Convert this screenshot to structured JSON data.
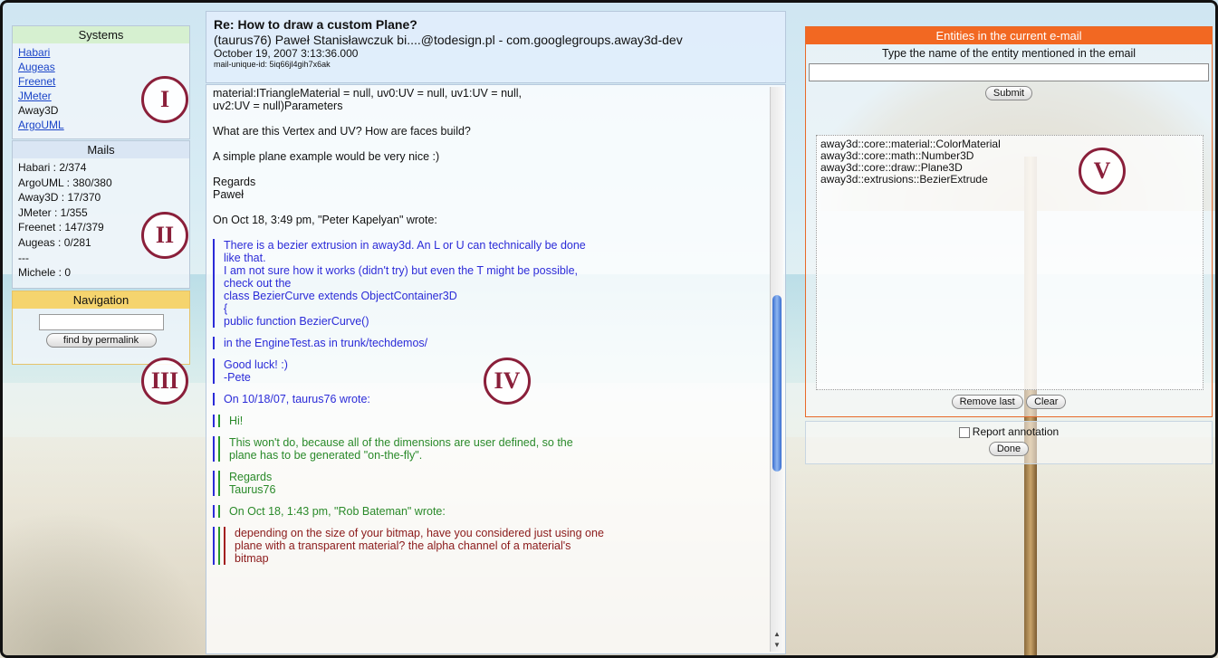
{
  "systems": {
    "title": "Systems",
    "items": [
      {
        "label": "Habari",
        "link": true
      },
      {
        "label": "Augeas",
        "link": true
      },
      {
        "label": "Freenet",
        "link": true
      },
      {
        "label": "JMeter",
        "link": true
      },
      {
        "label": "Away3D",
        "link": false
      },
      {
        "label": "ArgoUML",
        "link": true
      }
    ]
  },
  "mails": {
    "title": "Mails",
    "items": [
      "Habari : 2/374",
      "ArgoUML : 380/380",
      "Away3D : 17/370",
      "JMeter : 1/355",
      "Freenet : 147/379",
      "Augeas : 0/281",
      "---",
      "Michele : 0"
    ]
  },
  "navigation": {
    "title": "Navigation",
    "input_value": "",
    "button_label": "find by permalink"
  },
  "markers": [
    "I",
    "II",
    "III",
    "IV",
    "V"
  ],
  "email": {
    "subject": "Re: How to draw a custom Plane?",
    "from": "(taurus76) Paweł Stanisławczuk bi....@todesign.pl - com.googlegroups.away3d-dev",
    "date": "October 19, 2007 3:13:36.000",
    "mail_id": "mail-unique-id: 5iq66jl4gih7x6ak",
    "body": {
      "p1": [
        "material:ITriangleMaterial = null, uv0:UV = null, uv1:UV = null,",
        "uv2:UV = null)Parameters"
      ],
      "p2": "What are this Vertex and UV? How are faces build?",
      "p3": "A simple plane example would be very nice :)",
      "p4": [
        "Regards",
        "Paweł"
      ],
      "p5": "On Oct 18, 3:49 pm, \"Peter Kapelyan\" wrote:",
      "q1": [
        "There is a bezier extrusion in away3d. An L or U can technically be done",
        "like that.",
        "I am not sure how it works (didn't try) but even the T might be possible,",
        "check out the",
        "class BezierCurve extends ObjectContainer3D",
        "{",
        "public function BezierCurve()"
      ],
      "q2": "in the EngineTest.as in trunk/techdemos/",
      "q3": [
        "Good luck! :)",
        "-Pete"
      ],
      "q4": "On 10/18/07, taurus76 wrote:",
      "qq1": "Hi!",
      "qq2": [
        "This won't do, because all of the dimensions are user defined, so the",
        "plane has to be generated \"on-the-fly\"."
      ],
      "qq3": [
        "Regards",
        "Taurus76"
      ],
      "qq4": "On Oct 18, 1:43 pm, \"Rob Bateman\" wrote:",
      "qqq1": [
        "depending on the size of your bitmap, have you considered just using one",
        "plane with a transparent material? the alpha channel of a material's",
        "bitmap"
      ]
    }
  },
  "entities": {
    "title": "Entities in the current e-mail",
    "hint": "Type the name of the entity mentioned in the email",
    "input_value": "",
    "submit_label": "Submit",
    "list": [
      "away3d::core::material::ColorMaterial",
      "away3d::core::math::Number3D",
      "away3d::core::draw::Plane3D",
      "away3d::extrusions::BezierExtrude"
    ],
    "remove_label": "Remove last",
    "clear_label": "Clear"
  },
  "report": {
    "checkbox_label": "Report annotation",
    "checked": false,
    "done_label": "Done"
  },
  "colors": {
    "marker": "#8a1f3a",
    "entities_header": "#f26822",
    "navigation_header": "#f5d46e",
    "systems_header": "#d6f0d0",
    "quote_blue": "#2b2bd8",
    "quote_green": "#2a8a2a",
    "quote_red": "#8b1a1a"
  }
}
